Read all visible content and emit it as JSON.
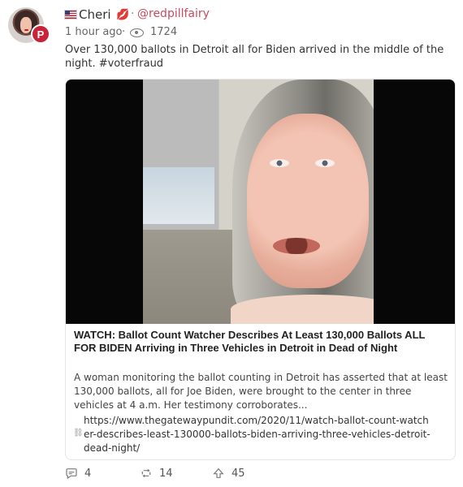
{
  "profile": {
    "display_name": "Cheri",
    "handle": "@redpillfairy",
    "badge": "P"
  },
  "meta": {
    "time": "1 hour ago",
    "views": "1724"
  },
  "post": {
    "text": "Over 130,000 ballots in Detroit all for Biden arrived in the middle of the night. #voterfraud"
  },
  "card": {
    "title": "WATCH: Ballot Count Watcher Describes At Least 130,000 Ballots ALL FOR BIDEN Arriving in Three Vehicles in Detroit in Dead of Night",
    "description": "A woman monitoring the ballot counting in Detroit has asserted that at least 130,000 ballots, all for Joe Biden, were brought to the center in three vehicles at 4 a.m. Her testimony corroborates...",
    "url": "https://www.thegatewaypundit.com/2020/11/watch-ballot-count-watcher-describes-least-130000-ballots-biden-arriving-three-vehicles-detroit-dead-night/"
  },
  "actions": {
    "comments": "4",
    "echoes": "14",
    "upvotes": "45"
  },
  "icons": {
    "flag": "us-flag-icon",
    "lips": "lips-icon",
    "eye": "eye-icon",
    "link": "link-icon",
    "comment": "comment-icon",
    "echo": "echo-icon",
    "upvote": "upvote-icon"
  },
  "colors": {
    "handle": "#c94b61",
    "badge": "#c7243a"
  }
}
